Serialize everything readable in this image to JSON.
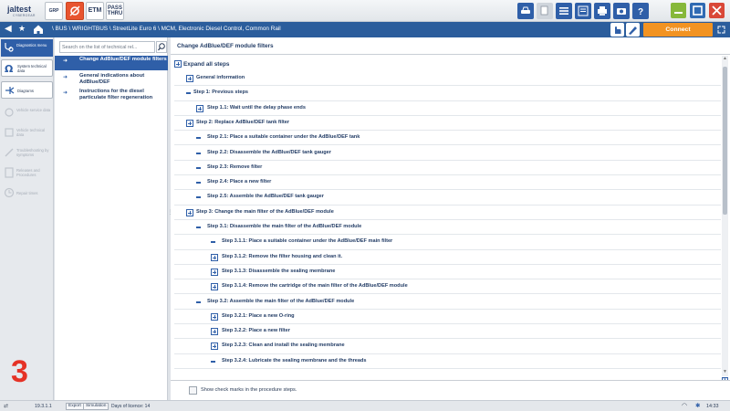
{
  "app": {
    "logo_text": "jaltest",
    "logo_sub": "CYBERGEAR"
  },
  "top_modules": [
    {
      "label": "GRP"
    },
    {
      "label": ""
    },
    {
      "label": "ETM"
    },
    {
      "label": "PASS THRU"
    }
  ],
  "toolbar_icons": [
    "car-wash-icon",
    "document-transfer-icon",
    "list-icon",
    "document-list-icon",
    "printer-icon",
    "camera-icon",
    "help-icon"
  ],
  "window_controls": [
    "minimize-icon",
    "maximize-icon",
    "close-icon"
  ],
  "nav": {
    "breadcrumb": "\\ BUS \\ WRIGHTBUS \\ StreetLite Euro 6 \\ MCM, Electronic Diesel Control, Common Rail",
    "connect_label": "Connect"
  },
  "rail": {
    "items": [
      {
        "label": "Diagnostics menu",
        "state": "selected",
        "icon": "stethoscope-icon"
      },
      {
        "label": "System technical data",
        "state": "boxed",
        "icon": "ohm-icon"
      },
      {
        "label": "Diagrams",
        "state": "boxed",
        "icon": "diagram-icon"
      },
      {
        "label": "Vehicle service data",
        "state": "dim",
        "icon": "service-icon"
      },
      {
        "label": "Vehicle technical data",
        "state": "dim",
        "icon": "tech-data-icon"
      },
      {
        "label": "Troubleshooting by symptoms",
        "state": "dim",
        "icon": "troubleshooting-icon"
      },
      {
        "label": "Releases and Procedures",
        "state": "dim",
        "icon": "procedures-icon"
      },
      {
        "label": "Repair times",
        "state": "dim",
        "icon": "repair-times-icon"
      }
    ]
  },
  "search": {
    "placeholder": "Search on the list of technical rel...",
    "items": [
      {
        "text": "Change AdBlue/DEF module filters",
        "selected": true
      },
      {
        "text": "General indications about AdBlue/DEF",
        "selected": false
      },
      {
        "text": "Instructions for the diesel particulate filter regeneration",
        "selected": false
      }
    ]
  },
  "main": {
    "title": "Change AdBlue/DEF module filters",
    "expand_all": "Expand all steps",
    "steps": [
      {
        "label": "General information",
        "marker": "plus",
        "level": 1
      },
      {
        "label": "Step 1: Previous steps",
        "marker": "dash",
        "level": 0
      },
      {
        "label": "Step 1.1: Wait until the delay phase ends",
        "marker": "plus",
        "level": 2
      },
      {
        "label": "Step 2: Replace AdBlue/DEF tank filter",
        "marker": "plus",
        "level": 1
      },
      {
        "label": "Step 2.1: Place a suitable container under the AdBlue/DEF tank",
        "marker": "dash",
        "level": 2
      },
      {
        "label": "Step 2.2: Disassemble the AdBlue/DEF tank gauger",
        "marker": "dash",
        "level": 2
      },
      {
        "label": "Step 2.3: Remove filter",
        "marker": "dash",
        "level": 2
      },
      {
        "label": "Step 2.4: Place a new filter",
        "marker": "dash",
        "level": 2
      },
      {
        "label": "Step 2.5: Assemble the AdBlue/DEF tank gauger",
        "marker": "dash",
        "level": 2
      },
      {
        "label": "Step 3: Change the main filter of the AdBlue/DEF module",
        "marker": "plus",
        "level": 1
      },
      {
        "label": "Step 3.1: Disassemble the main filter of the AdBlue/DEF module",
        "marker": "dash",
        "level": 2
      },
      {
        "label": "Step 3.1.1: Place a suitable container under the AdBlue/DEF main filter",
        "marker": "dash",
        "level": 3
      },
      {
        "label": "Step 3.1.2: Remove the filter housing and clean it.",
        "marker": "plus",
        "level": 3
      },
      {
        "label": "Step 3.1.3: Disassemble the sealing membrane",
        "marker": "plus",
        "level": 3
      },
      {
        "label": "Step 3.1.4: Remove the cartridge of the main filter of the AdBlue/DEF module",
        "marker": "plus",
        "level": 3
      },
      {
        "label": "Step 3.2: Assemble the main filter of the AdBlue/DEF module",
        "marker": "dash",
        "level": 2
      },
      {
        "label": "Step 3.2.1: Place a new O-ring",
        "marker": "plus",
        "level": 3
      },
      {
        "label": "Step 3.2.2: Place a new filter",
        "marker": "plus",
        "level": 3
      },
      {
        "label": "Step 3.2.3: Clean and install the sealing membrane",
        "marker": "plus",
        "level": 3
      },
      {
        "label": "Step 3.2.4: Lubricate the sealing membrane and the threads",
        "marker": "dash",
        "level": 3
      }
    ],
    "show_checkmarks_label": "Show check marks in the procedure steps.",
    "overlay_number": "3"
  },
  "status": {
    "version": "19.3.1.1",
    "export_label": "Export",
    "simulation_label": "Simulation",
    "days_of_licence": "Days of licence: 14",
    "time": "14:33"
  },
  "colors": {
    "accent_blue": "#2b5d9c",
    "connect_orange": "#f29322",
    "overlay_red": "#e53226"
  }
}
